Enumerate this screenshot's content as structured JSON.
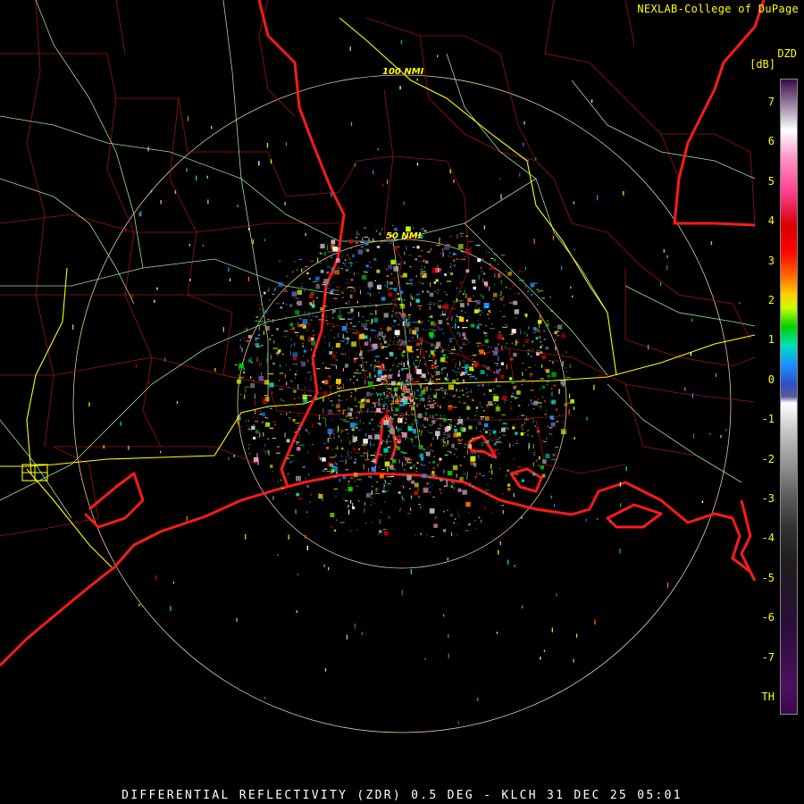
{
  "header": {
    "credit": "NEXLAB-College of DuPage"
  },
  "legend": {
    "product": "DZD",
    "unit": "[dB]",
    "ticks": [
      "7",
      "6",
      "5",
      "4",
      "3",
      "2",
      "1",
      "0",
      "-1",
      "-2",
      "-3",
      "-4",
      "-5",
      "-6",
      "-7",
      "TH"
    ]
  },
  "rings": {
    "inner_label": "50 NMI",
    "outer_label": "100 NMI"
  },
  "footer": {
    "caption": "DIFFERENTIAL REFLECTIVITY (ZDR) 0.5 DEG - KLCH 31 DEC 25 05:01"
  },
  "colors": {
    "coast": "#ff1a1a",
    "county": "#a01010",
    "highway": "#9be09b",
    "interstate": "#ffff00",
    "ring": "#e8c89a"
  }
}
